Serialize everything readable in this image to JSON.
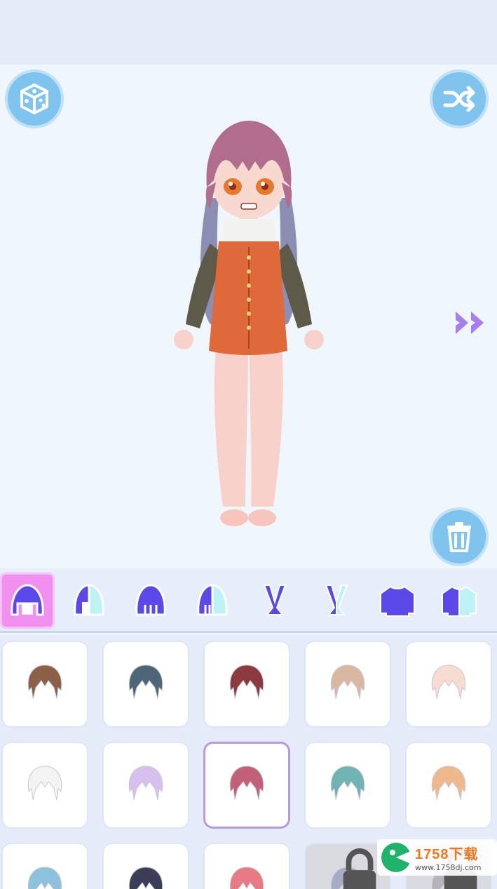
{
  "toolbar": {
    "random_icon": "dice-icon",
    "shuffle_icon": "shuffle-icon",
    "delete_icon": "trash-icon",
    "next_icon": "double-chevron-right-icon"
  },
  "tabs": [
    {
      "icon": "hair-front-icon",
      "active": true
    },
    {
      "icon": "hair-side-icon",
      "active": false
    },
    {
      "icon": "hair-back-icon",
      "active": false
    },
    {
      "icon": "hair-back-split-icon",
      "active": false
    },
    {
      "icon": "bunny-ears-icon",
      "active": false
    },
    {
      "icon": "bunny-ears-split-icon",
      "active": false
    },
    {
      "icon": "sweater-icon",
      "active": false
    },
    {
      "icon": "sweater-split-icon",
      "active": false
    }
  ],
  "hair_items": [
    {
      "color": "#8a6048"
    },
    {
      "color": "#4f6678"
    },
    {
      "color": "#8d3a3e"
    },
    {
      "color": "#d9b8a1"
    },
    {
      "color": "#f6ddd0"
    },
    {
      "color": "#f3f3f3"
    },
    {
      "color": "#d8c0ee"
    },
    {
      "color": "#c2607a",
      "selected": true
    },
    {
      "color": "#6fb3b2"
    },
    {
      "color": "#eeb98c"
    },
    {
      "color": "#8cc2db"
    },
    {
      "color": "#3c3e58"
    },
    {
      "color": "#e77a82"
    },
    {
      "color": "#a9acc6",
      "locked": true
    },
    {
      "color": "#b8b2bd",
      "locked": true
    }
  ],
  "watermark": {
    "brand": "1758下载",
    "url": "www.1758dj.com"
  },
  "colors": {
    "accent_blue": "#7fc3ef",
    "accent_purple": "#5a48e8",
    "active_tab": "#f190ee"
  }
}
